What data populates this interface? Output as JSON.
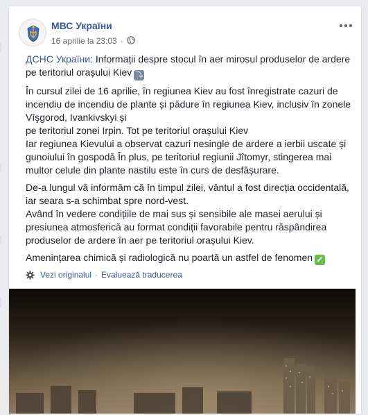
{
  "post": {
    "page_name": "МВС України",
    "timestamp": "16 aprilie la 23:03",
    "separator": "·",
    "audience_icon": "globe-icon",
    "more_icon": "more-options-icon",
    "source_link": "ДСНС України",
    "source_colon": ":",
    "title_text": " Informații despre stocul în aer mirosul produselor de ardere pe teritoriul orașului Kiev",
    "title_emoji": "repeat-arrow-icon",
    "paragraph_2_lines": [
      "În cursul zilei de 16 aprilie, în regiunea Kiev au fost înregistrate cazuri de incendiu de incendiu de plante și pădure în regiunea Kiev, inclusiv în zonele Vîşgorod, Ivankivskyi și",
      "pe teritoriul zonei Irpin. Tot pe teritoriul orașului Kiev",
      "Iar regiunea Kievului a observat cazuri nesingle de ardere a ierbii uscate și gunoiului în gospodă În plus, pe teritoriul regiunii Jîtomyr, stingerea mai multor celule din plante nastilu este în curs de desfășurare."
    ],
    "paragraph_3_lines": [
      "De-a lungul vă informăm că în timpul zilei, vântul a fost direcția occidentală, iar seara s-a schimbat spre nord-vest.",
      "Având în vedere condițiile de mai sus și sensibile ale masei aerului și presiunea atmosferică au format condiții favorabile pentru răspândirea produselor de ardere în aer pe teritoriul orașului Kiev."
    ],
    "paragraph_4": "Amenințarea chimică și radiologică nu poartă un astfel de fenomen",
    "paragraph_4_emoji": "check-mark-icon",
    "see_original": "Vezi originalul",
    "rate_translation": "Evaluează traducerea",
    "translate_separator": "·",
    "settings_icon": "gear-icon"
  },
  "colors": {
    "link": "#385898",
    "text": "#1d2129",
    "meta": "#616770",
    "background": "#e9ebee",
    "card": "#ffffff"
  }
}
